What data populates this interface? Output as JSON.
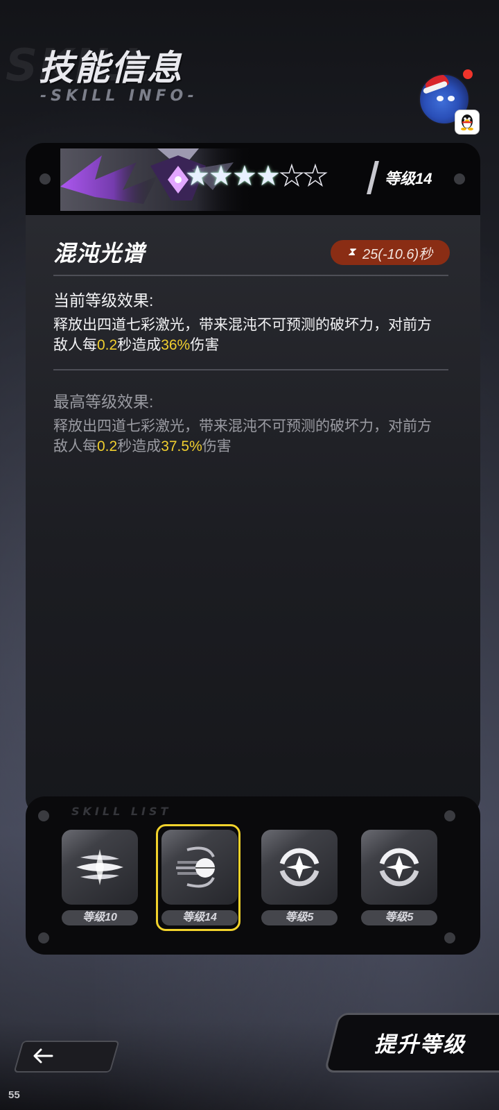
{
  "header": {
    "title": "技能信息",
    "subtitle": "-SKILL INFO-",
    "bg_text": "SKILL"
  },
  "skill": {
    "name": "混沌光谱",
    "level_label": "等级14",
    "stars_filled": 4,
    "stars_total": 6,
    "cooldown": "25(-10.6)秒",
    "current_title": "当前等级效果:",
    "current_desc": {
      "pre": "释放出四道七彩激光，带来混沌不可预测的破坏力，对前方敌人每",
      "v1": "0.2",
      "mid": "秒造成",
      "v2": "36%",
      "post": "伤害"
    },
    "max_title": "最高等级效果:",
    "max_desc": {
      "pre": "释放出四道七彩激光，带来混沌不可预测的破坏力，对前方敌人每",
      "v1": "0.2",
      "mid": "秒造成",
      "v2": "37.5%",
      "post": "伤害"
    }
  },
  "skill_list": {
    "label": "SKILL LIST",
    "items": [
      {
        "level": "等级10",
        "icon": "triple-blade-icon",
        "selected": false
      },
      {
        "level": "等级14",
        "icon": "spectrum-orb-icon",
        "selected": true
      },
      {
        "level": "等级5",
        "icon": "crosshair-star-icon",
        "selected": false
      },
      {
        "level": "等级5",
        "icon": "crosshair-star-icon",
        "selected": false
      }
    ]
  },
  "buttons": {
    "back_icon": "back-arrow-icon",
    "upgrade": "提升等级"
  },
  "status": {
    "fps": "55"
  },
  "colors": {
    "highlight": "#f1cf2f",
    "cooldown_bg": "#8a2d14",
    "selected_frame": "#f2d32c",
    "notification": "#f0342b"
  }
}
